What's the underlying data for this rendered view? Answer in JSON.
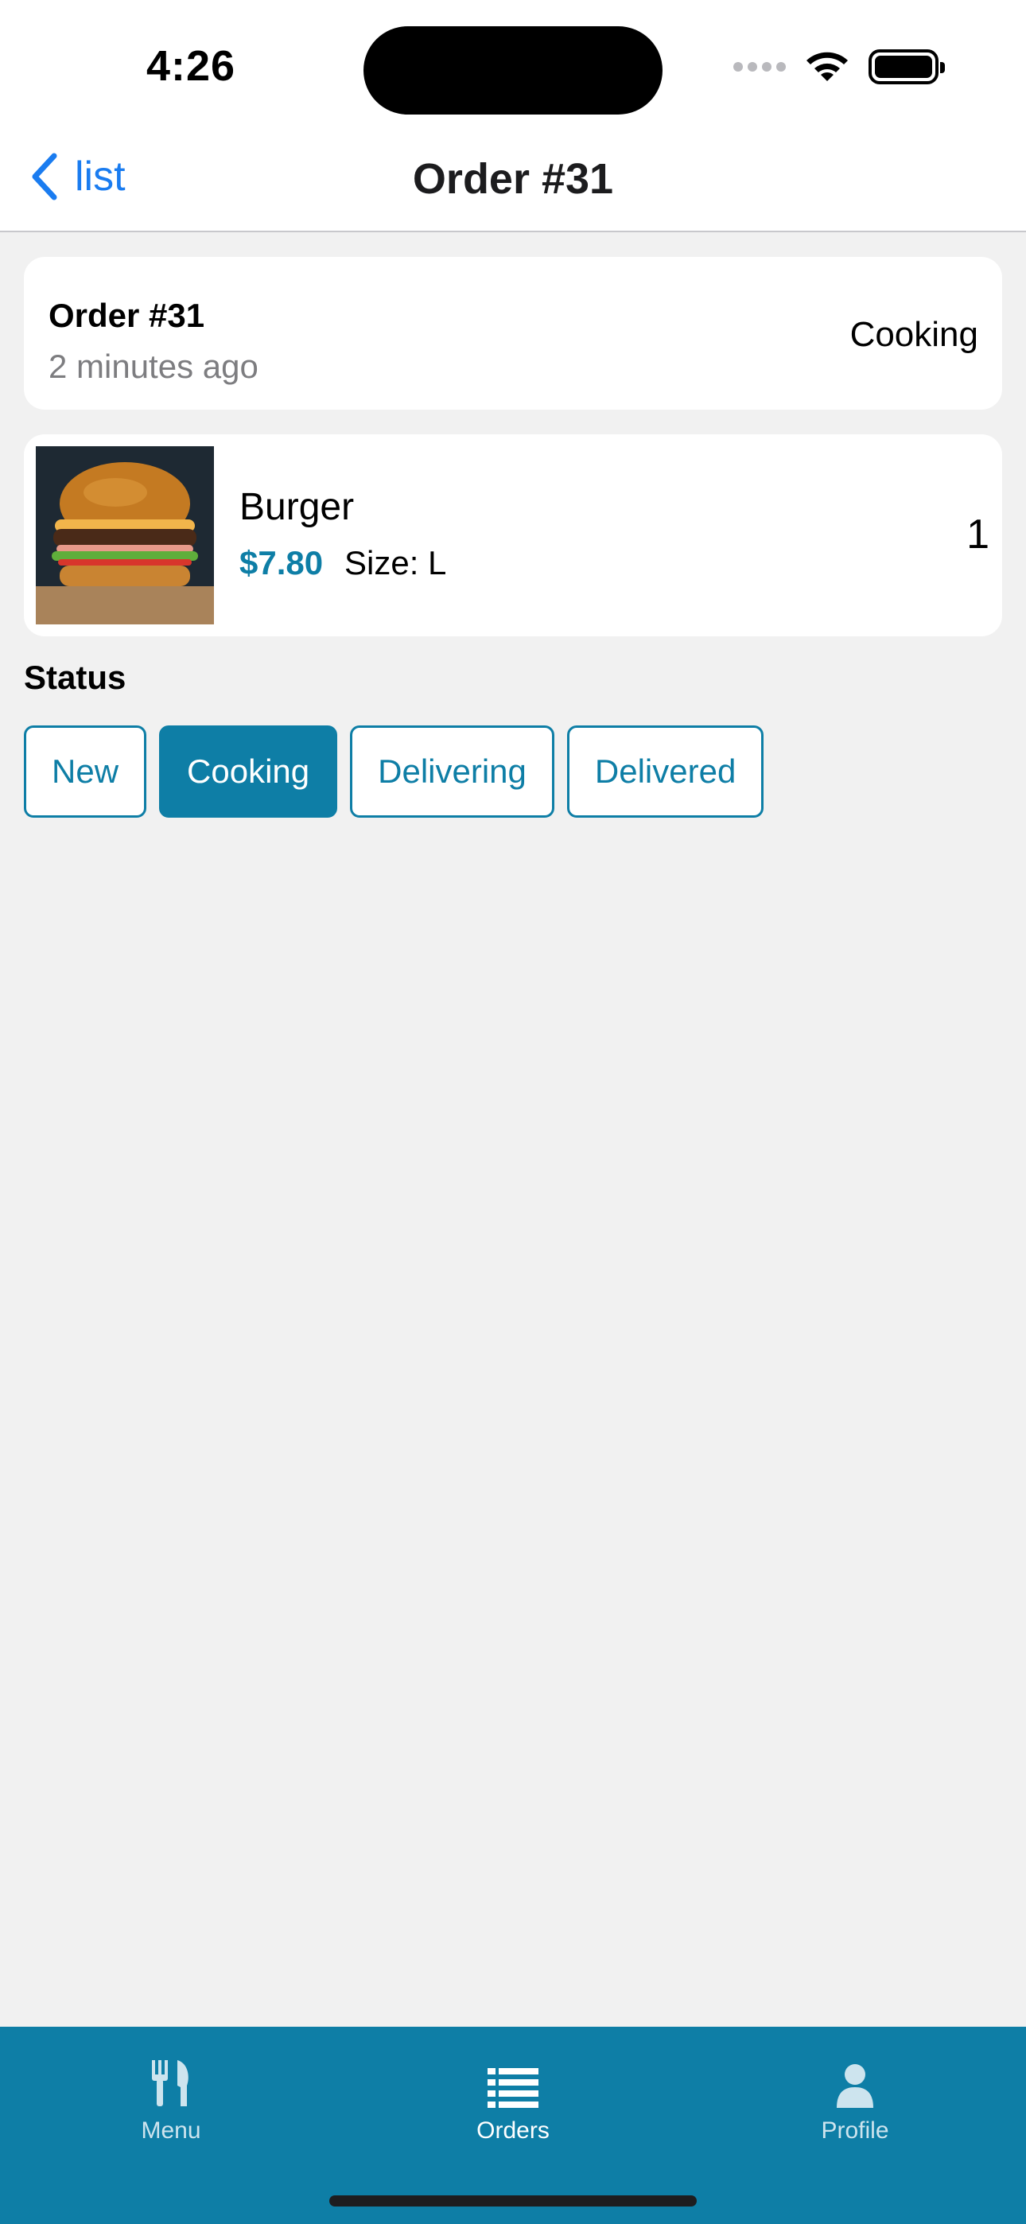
{
  "status_bar": {
    "time": "4:26"
  },
  "nav": {
    "back_label": "list",
    "title": "Order #31"
  },
  "order_card": {
    "title": "Order #31",
    "time_ago": "2 minutes ago",
    "status": "Cooking"
  },
  "item": {
    "name": "Burger",
    "price": "$7.80",
    "size": "Size: L",
    "quantity": "1"
  },
  "status_section": {
    "label": "Status",
    "options": [
      "New",
      "Cooking",
      "Delivering",
      "Delivered"
    ],
    "selected": "Cooking"
  },
  "tabbar": {
    "tabs": [
      {
        "label": "Menu",
        "icon": "fork-knife-icon"
      },
      {
        "label": "Orders",
        "icon": "list-icon"
      },
      {
        "label": "Profile",
        "icon": "person-icon"
      }
    ],
    "active": "Orders"
  },
  "colors": {
    "accent": "#0e7ea6",
    "link": "#1a7cf0",
    "background": "#f1f1f1"
  }
}
